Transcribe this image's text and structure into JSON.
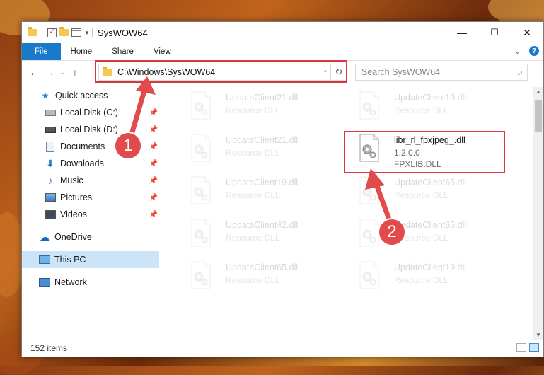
{
  "window": {
    "title": "SysWOW64",
    "minimize": "—",
    "maximize": "☐",
    "close": "✕"
  },
  "ribbon": {
    "tabs": [
      "File",
      "Home",
      "Share",
      "View"
    ]
  },
  "address_bar": {
    "path": "C:\\Windows\\SysWOW64"
  },
  "search": {
    "placeholder": "Search SysWOW64"
  },
  "sidebar": {
    "items": [
      {
        "label": "Quick access",
        "icon": "star-icon"
      },
      {
        "label": "Local Disk (C:)",
        "icon": "drive-icon",
        "pinned": true
      },
      {
        "label": "Local Disk (D:)",
        "icon": "drive-icon",
        "pinned": true
      },
      {
        "label": "Documents",
        "icon": "documents-icon",
        "pinned": true
      },
      {
        "label": "Downloads",
        "icon": "download-icon",
        "pinned": true
      },
      {
        "label": "Music",
        "icon": "music-icon",
        "pinned": true
      },
      {
        "label": "Pictures",
        "icon": "pictures-icon",
        "pinned": true
      },
      {
        "label": "Videos",
        "icon": "videos-icon",
        "pinned": true
      },
      {
        "label": "OneDrive",
        "icon": "cloud-icon"
      },
      {
        "label": "This PC",
        "icon": "computer-icon",
        "selected": true
      },
      {
        "label": "Network",
        "icon": "network-icon"
      }
    ]
  },
  "files": [
    {
      "name": "UpdateClient21.dll",
      "line1": "Resource DLL",
      "faded": true
    },
    {
      "name": "UpdateClient19.dll",
      "line1": "Resource DLL",
      "faded": true
    },
    {
      "name": "UpdateClient21.dll",
      "line1": "Resource DLL",
      "faded": true
    },
    {
      "name": "libr_rl_fpxjpeg_.dll",
      "line1": "1.2.0.0",
      "line2": "FPXLIB.DLL",
      "faded": false
    },
    {
      "name": "UpdateClient19.dll",
      "line1": "Resource DLL",
      "faded": true
    },
    {
      "name": "UpdateClient65.dll",
      "line1": "Resource DLL",
      "faded": true
    },
    {
      "name": "UpdateClient42.dll",
      "line1": "Resource DLL",
      "faded": true
    },
    {
      "name": "UpdateClient65.dll",
      "line1": "Resource DLL",
      "faded": true
    },
    {
      "name": "UpdateClient65.dll",
      "line1": "Resource DLL",
      "faded": true
    },
    {
      "name": "UpdateClient19.dll",
      "line1": "Resource DLL",
      "faded": true
    }
  ],
  "status": {
    "item_count": "152 items"
  },
  "annotations": {
    "badge1": "1",
    "badge2": "2",
    "color": "#e24b4b"
  }
}
